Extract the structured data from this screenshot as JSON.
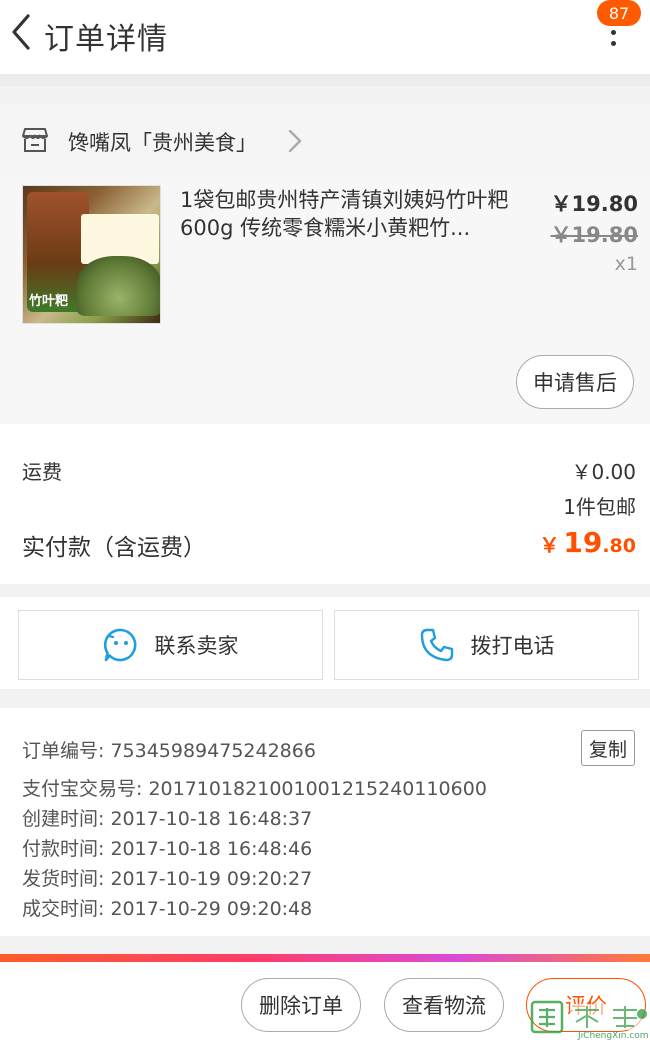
{
  "header": {
    "title": "订单详情",
    "badge_count": "87"
  },
  "shop": {
    "name": "馋嘴凤「贵州美食」"
  },
  "item": {
    "title": "1袋包邮贵州特产清镇刘姨妈竹叶粑600g 传统零食糯米小黄粑竹...",
    "price": "￥19.80",
    "original_price": "￥19.80",
    "quantity": "x1",
    "thumb_label": "竹叶粑",
    "after_sale_label": "申请售后"
  },
  "totals": {
    "shipping_label": "运费",
    "shipping_value": "￥0.00",
    "shipping_note": "1件包邮",
    "paid_label": "实付款（含运费）",
    "paid_currency": "￥",
    "paid_int": "19",
    "paid_dec": ".80"
  },
  "contact": {
    "seller_label": "联系卖家",
    "phone_label": "拨打电话"
  },
  "order_info": {
    "order_no": "订单编号: 75345989475242866",
    "copy_label": "复制",
    "alipay_no": "支付宝交易号: 2017101821001001215240110600",
    "created": "创建时间: 2017-10-18 16:48:37",
    "paid": "付款时间: 2017-10-18 16:48:46",
    "shipped": "发货时间: 2017-10-19 09:20:27",
    "completed": "成交时间: 2017-10-29 09:20:48"
  },
  "actions": {
    "delete_label": "删除订单",
    "logistics_label": "查看物流",
    "review_label": "评价"
  },
  "watermark": {
    "text": "JiChengXin.com"
  },
  "colors": {
    "accent": "#ff5000",
    "badge": "#ff5a00"
  }
}
